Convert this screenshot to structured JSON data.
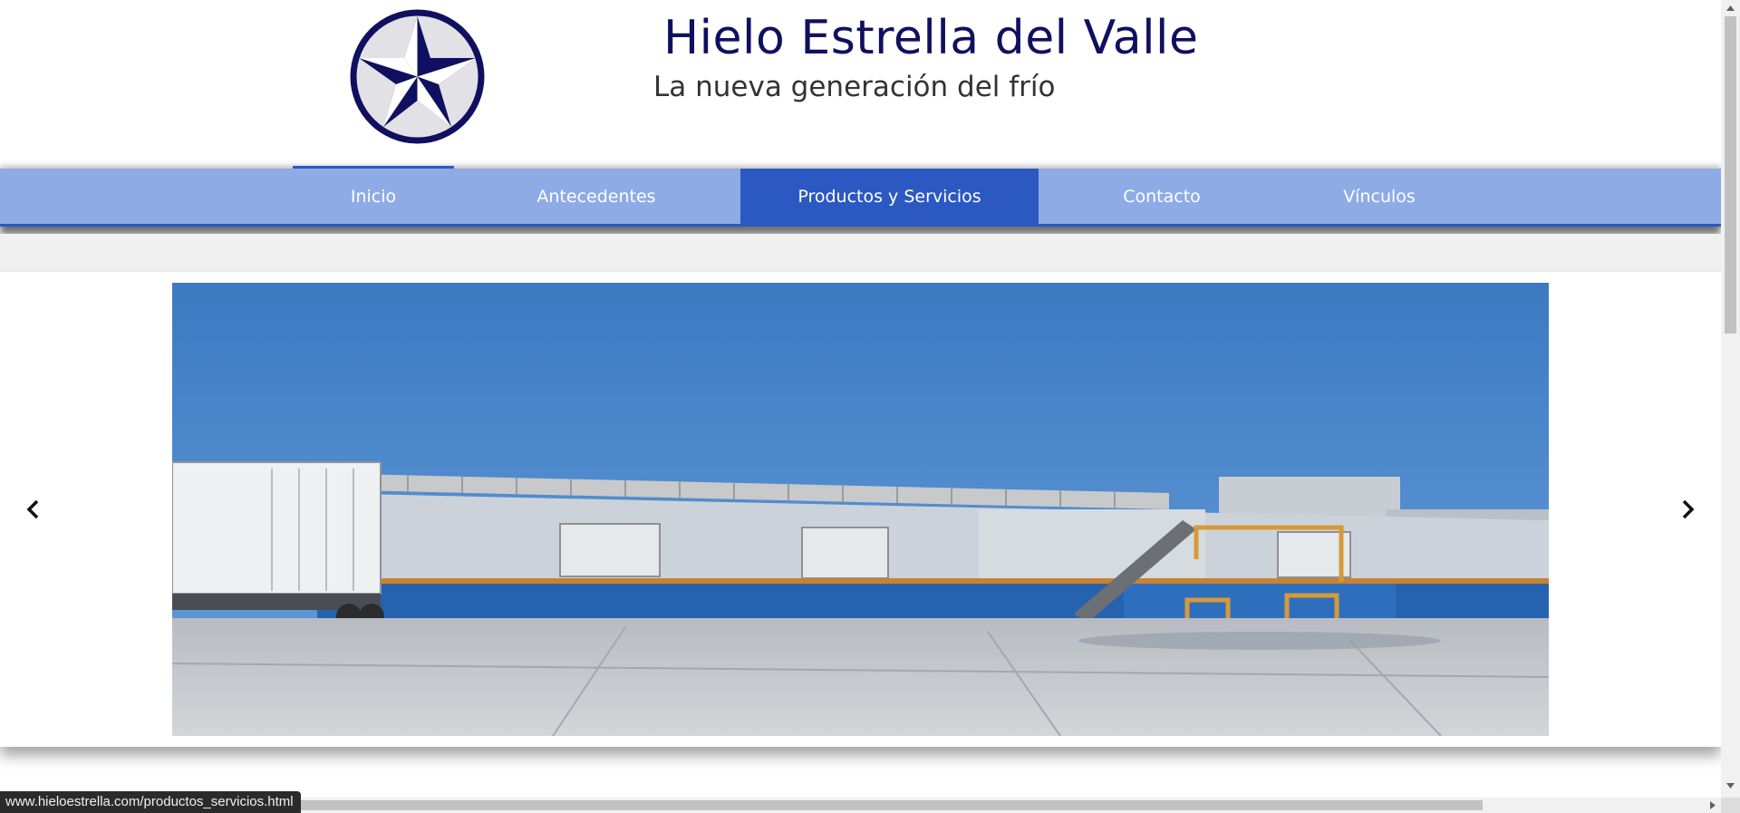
{
  "header": {
    "title": "Hielo Estrella del Valle",
    "subtitle": "La nueva generación del frío",
    "logo_icon": "star-emblem-icon"
  },
  "nav": {
    "items": [
      {
        "label": "Inicio",
        "state": "home"
      },
      {
        "label": "Antecedentes",
        "state": "normal"
      },
      {
        "label": "Productos y Servicios",
        "state": "active"
      },
      {
        "label": "Contacto",
        "state": "normal"
      },
      {
        "label": "Vínculos",
        "state": "normal"
      }
    ]
  },
  "slider": {
    "image": "ice-plant-building-photo",
    "prev_icon": "chevron-left-icon",
    "next_icon": "chevron-right-icon"
  },
  "status_bar": {
    "url": "www.hieloestrella.com/productos_servicios.html"
  },
  "colors": {
    "brand_navy": "#101060",
    "nav_background": "#8eabe6",
    "nav_active": "#2c58c2"
  }
}
